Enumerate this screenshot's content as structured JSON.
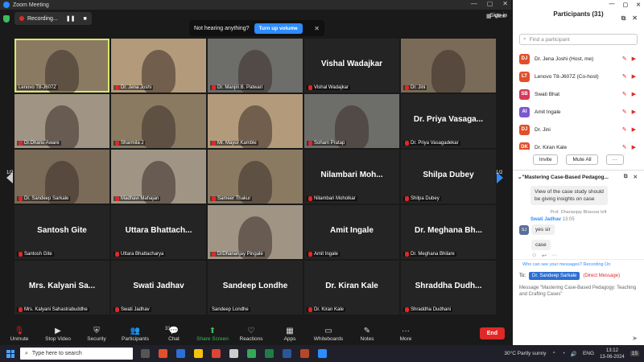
{
  "window": {
    "title": "Zoom Meeting"
  },
  "meeting": {
    "recording_label": "Recording...",
    "sign_in": "Sign in",
    "view": "View"
  },
  "notice": {
    "text": "Not hearing anything?",
    "button": "Turn up volume"
  },
  "gallery": {
    "page_left": "1/2",
    "page_right": "1/2",
    "tiles": [
      {
        "big": "",
        "label": "Lenovo T8-J607Z",
        "video": true,
        "active": true,
        "muted": false
      },
      {
        "big": "",
        "label": "Dr. Jena Joshi",
        "video": true,
        "muted": true
      },
      {
        "big": "",
        "label": "Dr. Manjiri B. Patwari",
        "video": true,
        "muted": true
      },
      {
        "big": "Vishal Wadajkar",
        "label": "Vishal Wadajkar",
        "video": false,
        "muted": true
      },
      {
        "big": "",
        "label": "Dr. Jini",
        "video": true,
        "muted": true
      },
      {
        "big": "",
        "label": "Dr.Dhanu Aware",
        "video": true,
        "muted": true
      },
      {
        "big": "",
        "label": "Sharmila J",
        "video": true,
        "muted": true
      },
      {
        "big": "",
        "label": "Mr. Mayur Kamble",
        "video": true,
        "muted": true
      },
      {
        "big": "",
        "label": "Soham Pratap",
        "video": true,
        "muted": true
      },
      {
        "big": "Dr. Priya Vasaga...",
        "label": "Dr. Priya Vasagadekar",
        "video": false,
        "muted": true
      },
      {
        "big": "",
        "label": "Dr. Sandeep Sarkale",
        "video": true,
        "muted": true
      },
      {
        "big": "",
        "label": "Madhavi Mahajan",
        "video": true,
        "muted": true
      },
      {
        "big": "",
        "label": "Sameer Thakur",
        "video": true,
        "muted": true
      },
      {
        "big": "Nilambari Moh...",
        "label": "Nilambari Moholkar",
        "video": false,
        "muted": true
      },
      {
        "big": "Shilpa Dubey",
        "label": "Shilpa Dubey",
        "video": false,
        "muted": true
      },
      {
        "big": "Santosh Gite",
        "label": "Santosh Gite",
        "video": false,
        "muted": true
      },
      {
        "big": "Uttara Bhattach...",
        "label": "Uttara Bhattacharya",
        "video": false,
        "muted": true
      },
      {
        "big": "",
        "label": "DrDhananjay Pingale",
        "video": true,
        "muted": true
      },
      {
        "big": "Amit Ingale",
        "label": "Amit Ingale",
        "video": false,
        "muted": true
      },
      {
        "big": "Dr. Meghana Bh...",
        "label": "Dr. Meghana Bhilare",
        "video": false,
        "muted": true
      },
      {
        "big": "Mrs. Kalyani Sa...",
        "label": "Mrs. Kalyani Sahastrabuddhe",
        "video": false,
        "muted": true
      },
      {
        "big": "Swati Jadhav",
        "label": "Swati Jadhav",
        "video": false,
        "muted": true
      },
      {
        "big": "Sandeep Londhe",
        "label": "Sandeep Londhe",
        "video": false,
        "muted": false
      },
      {
        "big": "Dr. Kiran Kale",
        "label": "Dr. Kiran Kale",
        "video": false,
        "muted": true
      },
      {
        "big": "Shraddha Dudh...",
        "label": "Shraddha Dudhani",
        "video": false,
        "muted": true
      }
    ]
  },
  "toolbar": {
    "unmute": "Unmute",
    "stop_video": "Stop Video",
    "security": "Security",
    "participants": "Participants",
    "participants_count": "31",
    "chat": "Chat",
    "share_screen": "Share Screen",
    "reactions": "Reactions",
    "apps": "Apps",
    "whiteboards": "Whiteboards",
    "notes": "Notes",
    "more": "More",
    "end": "End"
  },
  "participants_panel": {
    "title": "Participants (31)",
    "search_placeholder": "Find a participant",
    "items": [
      {
        "initials": "DJ",
        "name": "Dr. Jena Joshi (Host, me)",
        "color": "#e0502a"
      },
      {
        "initials": "LT",
        "name": "Lenovo T8-J607Z (Co-host)",
        "color": "#e0502a"
      },
      {
        "initials": "SB",
        "name": "Swati Bhat",
        "color": "#d63a5a"
      },
      {
        "initials": "AI",
        "name": "Amit Ingale",
        "color": "#7a58d0"
      },
      {
        "initials": "DJ",
        "name": "Dr. Jini",
        "color": "#e0502a"
      },
      {
        "initials": "DK",
        "name": "Dr. Kiran Kale",
        "color": "#e0502a"
      }
    ],
    "invite": "Invite",
    "mute_all": "Mute All",
    "more": "···"
  },
  "chat": {
    "title": "\"Mastering Case-Based Pedagog...",
    "msg_partial_1": "View of the case study should",
    "msg_partial_2": "be giving insights on case",
    "system_left": "Prof. Dhananjay Bhavsar left",
    "sender": "Swati Jadhav",
    "sender_time": "13:05",
    "sender_initials": "SJ",
    "msg1": "yes sir",
    "msg2": "case",
    "visibility": "Who can see your messages? Recording On",
    "to_label": "To:",
    "to_value": "Dr. Sandeep Sarkale",
    "direct": "(Direct Message)",
    "placeholder": "Message \"Mastering Case-Based Pedagogy: Teaching and Crafting Cases\""
  },
  "taskbar": {
    "search": "Type here to search",
    "weather": "30°C  Partly sunny",
    "lang": "ENG",
    "time": "13:12",
    "date": "13-06-2024",
    "notif": "15"
  }
}
